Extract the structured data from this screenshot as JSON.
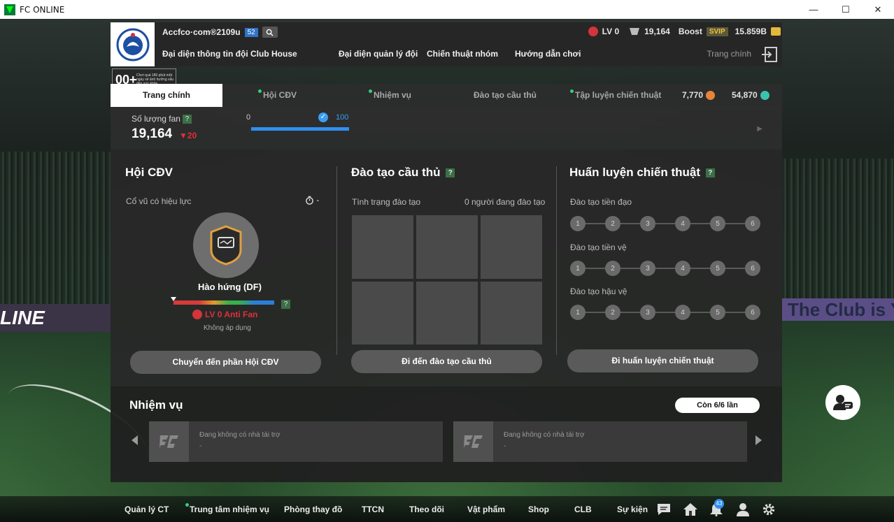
{
  "window": {
    "title": "FC ONLINE"
  },
  "header": {
    "username": "Accfco·com®2109u",
    "level_badge": "52",
    "lv_text": "LV 0",
    "fan_stat": "19,164",
    "boost_label": "Boost",
    "svip_label": "SVIP",
    "bp_value": "15.859B",
    "nav": [
      "Đại diện thông tin đội",
      "Club House",
      "Đại diện quản lý đội",
      "Chiến thuật nhóm",
      "Hướng dẫn chơi"
    ],
    "home_label": "Trang chính"
  },
  "age_badge": {
    "age": "00+",
    "note": "Chơi quá 180 phút một ngày sẽ ảnh hưởng xấu đến sức khỏe"
  },
  "tabs": {
    "items": [
      "Trang chính",
      "Hội CĐV",
      "Nhiệm vụ",
      "Đào tạo cầu thủ",
      "Tập luyện chiến thuật"
    ],
    "currency_1": "7,770",
    "currency_2": "54,870"
  },
  "fan": {
    "label": "Số lượng fan",
    "count": "19,164",
    "change": "20",
    "progress_min": "0",
    "progress_max": "100",
    "progress_fraction": 1.0
  },
  "fanclub": {
    "title": "Hội CĐV",
    "effect_label": "Cổ vũ có hiệu lực",
    "timer_value": "-",
    "mood": "Hào hứng (DF)",
    "antifan": "LV 0 Anti Fan",
    "not_applied": "Không áp dụng",
    "button": "Chuyển đến phần Hội CĐV"
  },
  "training": {
    "title": "Đào tạo cầu thủ",
    "status_label": "Tình trạng đào tạo",
    "status_value": "0 người đang đào tạo",
    "button": "Đi đến đào tạo cầu thủ"
  },
  "tactics": {
    "title": "Huấn luyện chiến thuật",
    "rows": [
      "Đào tạo tiền đạo",
      "Đào tạo tiền vệ",
      "Đào tạo hậu vệ"
    ],
    "steps": [
      "1",
      "2",
      "3",
      "4",
      "5",
      "6"
    ],
    "button": "Đi huấn luyện chiến thuật"
  },
  "missions": {
    "title": "Nhiệm vụ",
    "remaining": "Còn 6/6 lần",
    "cards": [
      {
        "text": "Đang không có nhà tài trợ",
        "sub": "-"
      },
      {
        "text": "Đang không có nhà tài trợ",
        "sub": "-"
      }
    ]
  },
  "background": {
    "ad_left": "LINE",
    "ad_right": "The Club is Y"
  },
  "bottom_nav": {
    "items": [
      "Quản lý CT",
      "Trung tâm nhiệm vụ",
      "Phòng thay đồ",
      "TTCN",
      "Theo dõi",
      "Vật phẩm",
      "Shop",
      "CLB",
      "Sự kiện"
    ],
    "notification_count": "43"
  },
  "colors": {
    "accent_blue": "#2f8ff0",
    "alert_red": "#e0303a",
    "green_dot": "#33d17a"
  },
  "icons": [
    "fc-online-app-icon",
    "search-icon",
    "exit-icon",
    "check-icon",
    "timer-icon",
    "chat-icon",
    "home-icon",
    "bell-icon",
    "profile-icon",
    "gear-icon",
    "fan-support-icon"
  ]
}
